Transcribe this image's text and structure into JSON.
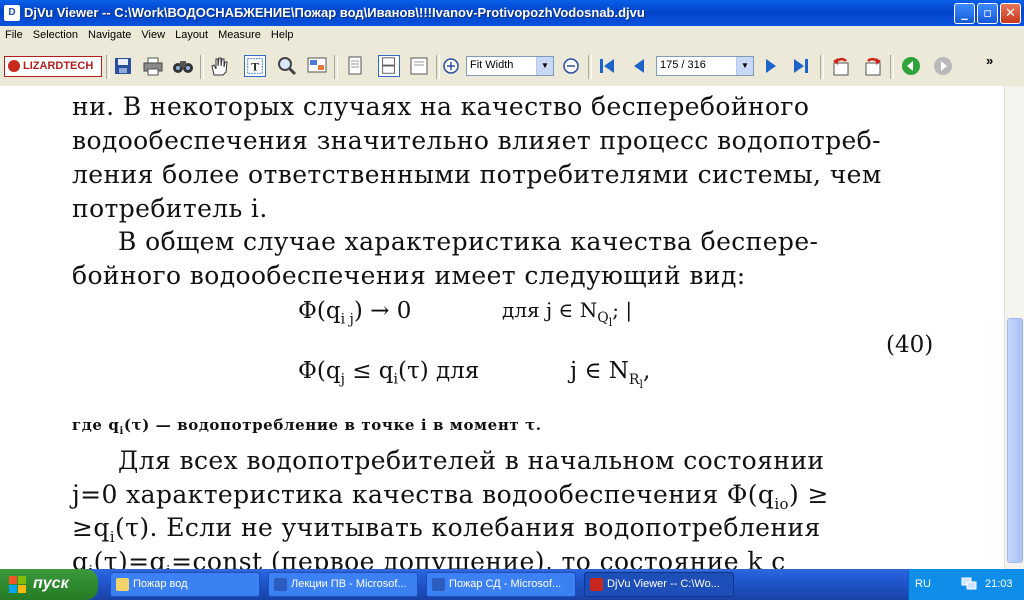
{
  "window": {
    "title": "DjVu Viewer -- C:\\Work\\ВОДОСНАБЖЕНИЕ\\Пожар вод\\Иванов\\!!!Ivanov-ProtivopozhVodosnab.djvu",
    "minimize": "_",
    "maximize": "▫",
    "close": "✕"
  },
  "menu": [
    "File",
    "Selection",
    "Navigate",
    "View",
    "Layout",
    "Measure",
    "Help"
  ],
  "toolbar": {
    "logo": "LIZARDTECH",
    "zoom_value": "Fit Width",
    "page_value": "175 / 316",
    "overflow": "»"
  },
  "document": {
    "lines": [
      "ни. В некоторых случаях на качество бесперебойного",
      "водообеспечения значительно влияет процесс водопотреб-",
      "ления более ответственными потребителями системы, чем",
      "потребитель i.",
      "В общем случае характеристика качества беспере-",
      "бойного водообеспечения имеет следующий вид:"
    ],
    "formula_line1_left": "Φ(q",
    "formula_line1_sub": "i j",
    "formula_line1_right": ") → 0",
    "formula_line1_cond": "для   j ∈ N",
    "formula_line1_condsub": "Q",
    "formula_line1_condsub2": "l",
    "formula_line1_end": "; |",
    "formula_line2_left": "Φ(q",
    "formula_line2_sub": "j",
    "formula_line2_mid": "≤ q",
    "formula_line2_mid_sub": "i",
    "formula_line2_right": "(τ) для",
    "formula_line2_cond": "j ∈ N",
    "formula_line2_condsub": "R",
    "formula_line2_condsub2": "l",
    "formula_line2_end": ",",
    "equation_number": "(40)",
    "note": "где q",
    "note_sub": "i",
    "note_rest": "(τ) — водопотребление в точке i в момент τ.",
    "lines2": [
      "Для всех водопотребителей в начальном состоянии",
      "j=0 характеристика качества водообеспечения Φ(q",
      "≥q",
      "q"
    ],
    "line8_sub": "io",
    "line8_end": ") ≥",
    "line9_sub": "i",
    "line9_rest": "(τ). Если не учитывать колебания водопотребления",
    "line10_sub": "i",
    "line10_mid": "(τ)=q",
    "line10_sub2": "i",
    "line10_rest": "=const (первое допущение), то состояние k с"
  },
  "taskbar": {
    "start": "пуск",
    "tasks": [
      {
        "label": "Пожар вод",
        "icon_color": "#f2d36b"
      },
      {
        "label": "Лекции ПВ - Microsof...",
        "icon_color": "#2b5cbe"
      },
      {
        "label": "Пожар СД - Microsof...",
        "icon_color": "#2b5cbe"
      },
      {
        "label": "DjVu Viewer -- C:\\Wo...",
        "icon_color": "#c8281e"
      }
    ],
    "lang": "RU",
    "clock": "21:03"
  }
}
